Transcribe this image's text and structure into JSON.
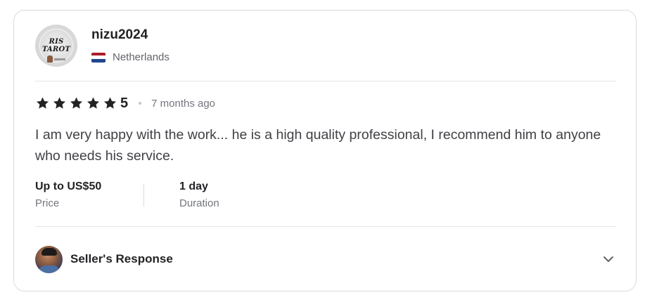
{
  "review": {
    "user": {
      "name": "nizu2024",
      "avatar_text": "RIS TAROT",
      "country": "Netherlands",
      "flag_colors": [
        "#ae1c28",
        "#ffffff",
        "#21468b"
      ]
    },
    "rating": {
      "stars": 5,
      "value": "5",
      "star_color": "#222325"
    },
    "time_ago": "7 months ago",
    "text": "I am very happy with the work... he is a high quality professional, I recommend him to anyone who needs his service.",
    "stats": [
      {
        "value": "Up to US$50",
        "label": "Price"
      },
      {
        "value": "1 day",
        "label": "Duration"
      }
    ],
    "seller_response": {
      "label": "Seller's Response",
      "icon": "chevron-down-icon"
    }
  }
}
